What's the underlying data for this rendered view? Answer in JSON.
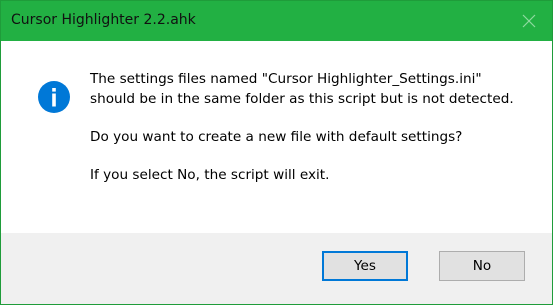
{
  "window": {
    "title": "Cursor Highlighter 2.2.ahk"
  },
  "dialog": {
    "icon": "information-icon",
    "message_line1": "The settings files named \"Cursor Highlighter_Settings.ini\"\nshould be in the same folder as this script but is not detected.",
    "message_line2": "Do you want to create a new file with default settings?",
    "message_line3": "If you select No, the script will exit."
  },
  "buttons": {
    "yes_label": "Yes",
    "no_label": "No"
  },
  "colors": {
    "titlebar": "#22b043",
    "info_icon": "#0078d7",
    "footer": "#f0f0f0"
  }
}
